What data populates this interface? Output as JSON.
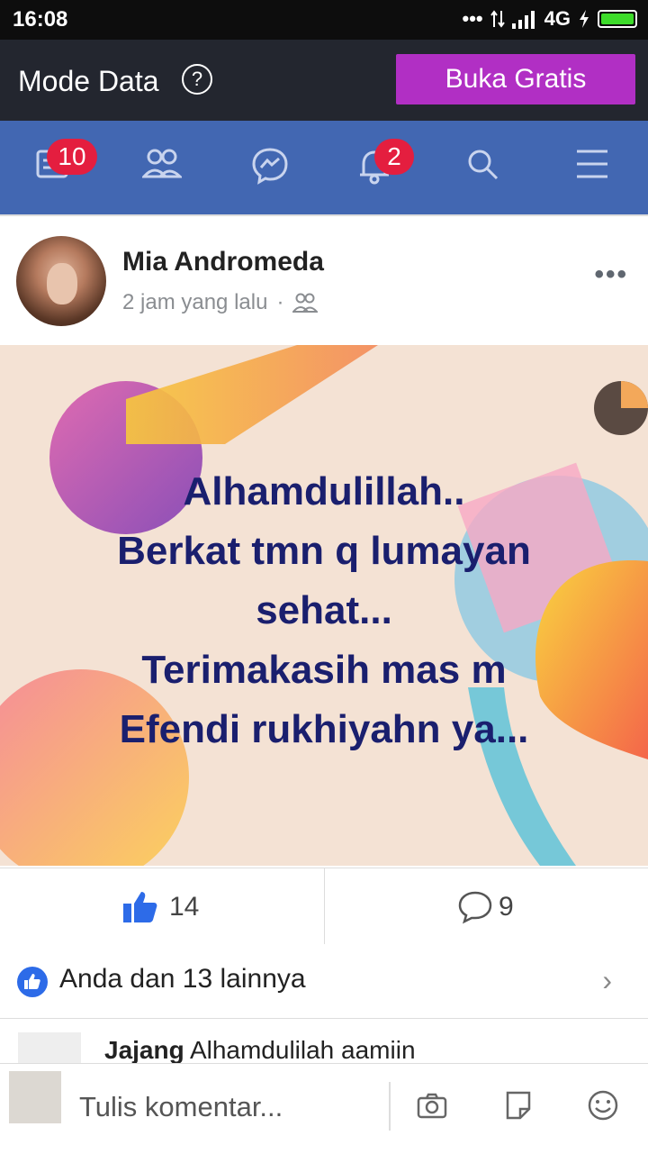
{
  "status_bar": {
    "time": "16:08",
    "network": "4G",
    "icons": [
      "dots-icon",
      "data-arrows-icon",
      "signal-icon",
      "charging-icon",
      "battery-icon"
    ]
  },
  "data_mode": {
    "label": "Mode Data",
    "help_icon": "?",
    "button_label": "Buka Gratis"
  },
  "nav": {
    "items": [
      {
        "name": "news-feed",
        "icon": "feed-icon",
        "badge": "10"
      },
      {
        "name": "friends",
        "icon": "friends-icon",
        "badge": ""
      },
      {
        "name": "messenger",
        "icon": "messenger-icon",
        "badge": ""
      },
      {
        "name": "notifications",
        "icon": "bell-icon",
        "badge": "2"
      },
      {
        "name": "search",
        "icon": "search-icon",
        "badge": ""
      },
      {
        "name": "menu",
        "icon": "hamburger-icon",
        "badge": ""
      }
    ]
  },
  "post": {
    "author": "Mia Andromeda",
    "time": "2 jam yang lalu",
    "separator": "·",
    "lines": [
      "Alhamdulillah..",
      "Berkat tmn q lumayan",
      "sehat...",
      "Terimakasih mas m",
      "Efendi rukhiyahn ya..."
    ],
    "likes": "14",
    "comments": "9",
    "reactions_text": "Anda dan 13 lainnya",
    "comment_preview_author": "Jajang",
    "comment_preview_text": " Alhamdulilah aamiin"
  },
  "composer": {
    "placeholder": "Tulis komentar..."
  },
  "colors": {
    "nav_bg": "#4267b2",
    "data_bar_bg": "#23262f",
    "buka_button": "#b12fc4",
    "badge": "#e41e3f",
    "post_text": "#1a1f6e",
    "like_blue": "#2d6be8"
  }
}
